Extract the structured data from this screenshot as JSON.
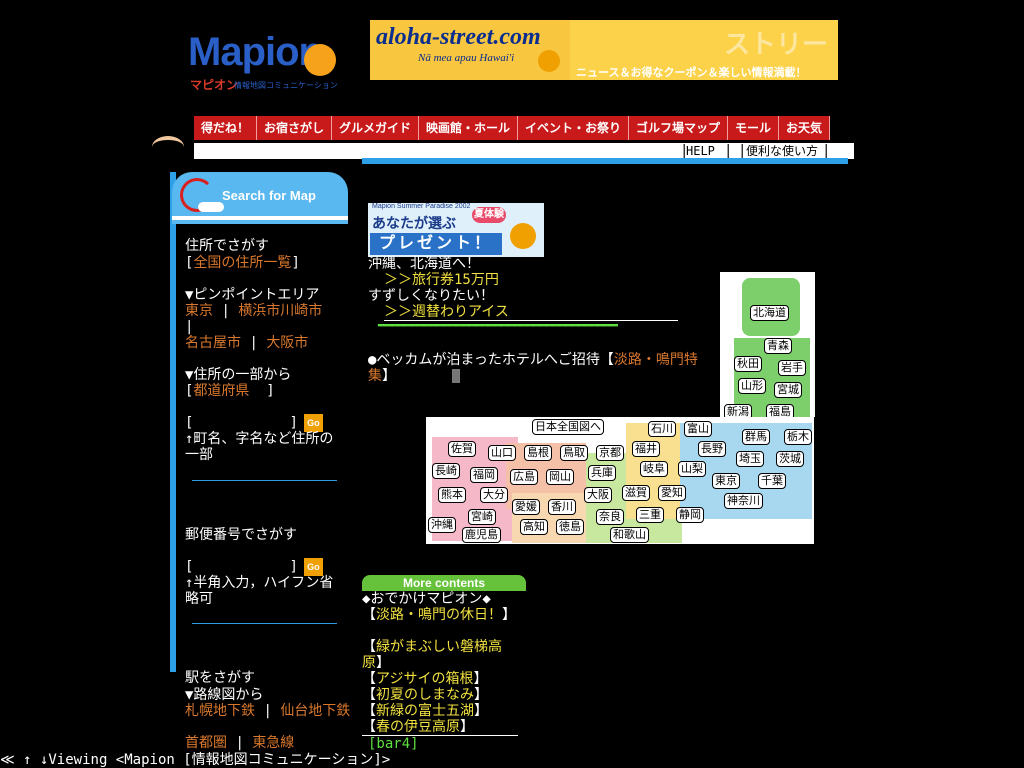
{
  "logo": {
    "name": "Mapion",
    "sub": "マピオン",
    "sub2": "情報地図コミュニケーション"
  },
  "banner": {
    "title": "aloha-street.com",
    "subtitle": "Nā mea apau Hawai'i",
    "tagline": "ニュース＆お得なクーポン＆楽しい情報満載！",
    "ghost": "ストリー"
  },
  "nav": [
    "得だね！",
    "お宿さがし",
    "グルメガイド",
    "映画館・ホール",
    "イベント・お祭り",
    "ゴルフ場マップ",
    "モール",
    "お天気"
  ],
  "subbar": {
    "help": "HELP",
    "howto": "便利な使い方"
  },
  "search": {
    "header": "Search for Map",
    "address_title": "住所でさがす",
    "address_link": "全国の住所一覧",
    "pinpoint_title": "▼ピンポイントエリア",
    "pinpoint_links": [
      "東京",
      "横浜市川崎市",
      "名古屋市",
      "大阪市"
    ],
    "partial_title": "▼住所の一部から",
    "prefecture_link": "都道府県",
    "partial_hint": "↑町名、字名など住所の一部",
    "postal_title": "郵便番号でさがす",
    "postal_hint": "↑半角入力，ハイフン省略可",
    "station_title": "駅をさがす",
    "route_title": "▼路線図から",
    "route_links": [
      "札幌地下鉄",
      "仙台地下鉄",
      "首都圏",
      "東急線"
    ],
    "go": "Go"
  },
  "promo": {
    "small": "Mapion Summer Paradise 2002",
    "title": "あなたが選ぶ",
    "badge": "夏体験",
    "present": "プレゼント！"
  },
  "news": {
    "l1": "沖縄、北海道へ！",
    "l2": "＞＞旅行券15万円",
    "l3": "すずしくなりたい！",
    "l4": "＞＞週替わりアイス",
    "l5a": "●ベッカムが泊まったホテルへご招待【",
    "l5b": "淡路・鳴門特集",
    "l5c": "】"
  },
  "map": {
    "title": "日本全国図へ",
    "tohoku": [
      "北海道",
      "青森",
      "秋田",
      "岩手",
      "山形",
      "宮城",
      "新潟",
      "福島"
    ],
    "prefs": [
      "石川",
      "富山",
      "群馬",
      "栃木",
      "佐賀",
      "山口",
      "島根",
      "鳥取",
      "京都",
      "福井",
      "長野",
      "埼玉",
      "茨城",
      "長崎",
      "福岡",
      "広島",
      "岡山",
      "兵庫",
      "岐阜",
      "山梨",
      "東京",
      "千葉",
      "熊本",
      "大分",
      "大阪",
      "滋賀",
      "愛知",
      "愛媛",
      "香川",
      "神奈川",
      "宮崎",
      "奈良",
      "三重",
      "静岡",
      "沖縄",
      "高知",
      "徳島",
      "鹿児島",
      "和歌山"
    ]
  },
  "more": {
    "header": "More contents",
    "title": "◆おでかけマピオン◆",
    "items": [
      "淡路・鳴門の休日！",
      "緑がまぶしい磐梯高原",
      "アジサイの箱根",
      "初夏のしまなみ",
      "新緑の富士五湖",
      "春の伊豆高原"
    ],
    "bar": "[bar4]"
  },
  "status": "≪ ↑ ↓Viewing <Mapion [情報地図コミュニケーション]>"
}
